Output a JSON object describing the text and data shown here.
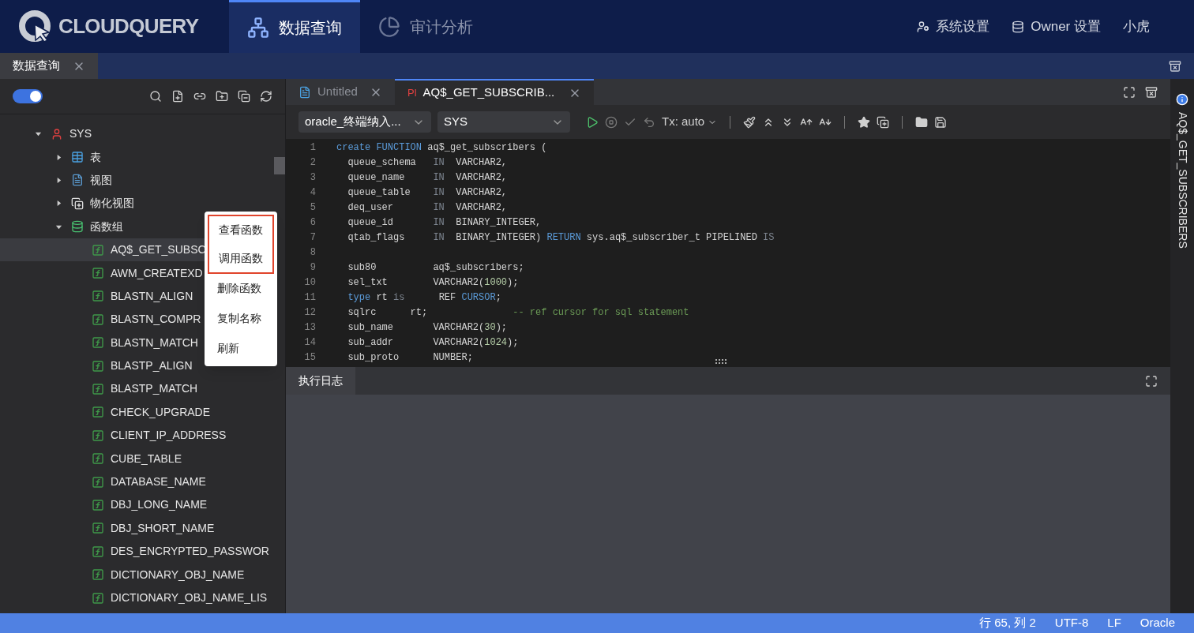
{
  "header": {
    "logo": "CLOUDQUERY",
    "nav": [
      {
        "label": "数据查询",
        "selected": true
      },
      {
        "label": "审计分析",
        "selected": false
      }
    ],
    "actions": [
      "系统设置",
      "Owner 设置",
      "小虎"
    ]
  },
  "page_tabs": [
    {
      "label": "数据查询",
      "selected": true
    }
  ],
  "sidebar": {
    "theme_toggle": {
      "on": true
    },
    "tree": [
      {
        "label": "SYS",
        "kind": "user",
        "expanded": true,
        "children": [
          {
            "label": "表",
            "kind": "table",
            "expanded": false
          },
          {
            "label": "视图",
            "kind": "view",
            "expanded": false
          },
          {
            "label": "物化视图",
            "kind": "mview",
            "expanded": false
          },
          {
            "label": "函数组",
            "kind": "funcgroup",
            "expanded": true,
            "children": [
              {
                "label": "AQ$_GET_SUBSC",
                "kind": "func",
                "selected": true
              },
              {
                "label": "AWM_CREATEXD",
                "kind": "func",
                "selected": false
              },
              {
                "label": "BLASTN_ALIGN",
                "kind": "func",
                "selected": false
              },
              {
                "label": "BLASTN_COMPR",
                "kind": "func",
                "selected": false
              },
              {
                "label": "BLASTN_MATCH",
                "kind": "func",
                "selected": false
              },
              {
                "label": "BLASTP_ALIGN",
                "kind": "func",
                "selected": false
              },
              {
                "label": "BLASTP_MATCH",
                "kind": "func",
                "selected": false
              },
              {
                "label": "CHECK_UPGRADE",
                "kind": "func",
                "selected": false
              },
              {
                "label": "CLIENT_IP_ADDRESS",
                "kind": "func",
                "selected": false
              },
              {
                "label": "CUBE_TABLE",
                "kind": "func",
                "selected": false
              },
              {
                "label": "DATABASE_NAME",
                "kind": "func",
                "selected": false
              },
              {
                "label": "DBJ_LONG_NAME",
                "kind": "func",
                "selected": false
              },
              {
                "label": "DBJ_SHORT_NAME",
                "kind": "func",
                "selected": false
              },
              {
                "label": "DES_ENCRYPTED_PASSWOR",
                "kind": "func",
                "selected": false
              },
              {
                "label": "DICTIONARY_OBJ_NAME",
                "kind": "func",
                "selected": false
              },
              {
                "label": "DICTIONARY_OBJ_NAME_LIS",
                "kind": "func",
                "selected": false
              }
            ]
          }
        ]
      }
    ]
  },
  "context_menu": [
    {
      "label": "查看函数",
      "highlighted": true
    },
    {
      "label": "调用函数",
      "highlighted": true
    },
    {
      "label": "删除函数",
      "highlighted": false
    },
    {
      "label": "复制名称",
      "highlighted": false
    },
    {
      "label": "刷新",
      "highlighted": false
    }
  ],
  "editor": {
    "tabs": [
      {
        "label": "Untitled",
        "kind": "file",
        "selected": false
      },
      {
        "label": "AQ$_GET_SUBSCRIB...",
        "kind": "plsql",
        "prefix": "Pl",
        "selected": true
      }
    ],
    "connection": "oracle_终端纳入...",
    "schema": "SYS",
    "tx": "Tx: auto",
    "lines": [
      {
        "no": "1",
        "tokens": [
          {
            "kind": "kw",
            "text": "create FUNCTION"
          },
          {
            "kind": "plain",
            "text": " aq$_get_subscribers ("
          }
        ]
      },
      {
        "no": "2",
        "tokens": [
          {
            "kind": "plain",
            "text": "  queue_schema   "
          },
          {
            "kind": "dim",
            "text": "IN"
          },
          {
            "kind": "plain",
            "text": "  VARCHAR2,"
          }
        ]
      },
      {
        "no": "3",
        "tokens": [
          {
            "kind": "plain",
            "text": "  queue_name     "
          },
          {
            "kind": "dim",
            "text": "IN"
          },
          {
            "kind": "plain",
            "text": "  VARCHAR2,"
          }
        ]
      },
      {
        "no": "4",
        "tokens": [
          {
            "kind": "plain",
            "text": "  queue_table    "
          },
          {
            "kind": "dim",
            "text": "IN"
          },
          {
            "kind": "plain",
            "text": "  VARCHAR2,"
          }
        ]
      },
      {
        "no": "5",
        "tokens": [
          {
            "kind": "plain",
            "text": "  deq_user       "
          },
          {
            "kind": "dim",
            "text": "IN"
          },
          {
            "kind": "plain",
            "text": "  VARCHAR2,"
          }
        ]
      },
      {
        "no": "6",
        "tokens": [
          {
            "kind": "plain",
            "text": "  queue_id       "
          },
          {
            "kind": "dim",
            "text": "IN"
          },
          {
            "kind": "plain",
            "text": "  BINARY_INTEGER,"
          }
        ]
      },
      {
        "no": "7",
        "tokens": [
          {
            "kind": "plain",
            "text": "  qtab_flags     "
          },
          {
            "kind": "dim",
            "text": "IN"
          },
          {
            "kind": "plain",
            "text": "  BINARY_INTEGER) "
          },
          {
            "kind": "kw",
            "text": "RETURN"
          },
          {
            "kind": "plain",
            "text": " sys.aq$_subscriber_t PIPELINED "
          },
          {
            "kind": "dim",
            "text": "IS"
          }
        ]
      },
      {
        "no": "8"
      },
      {
        "no": "9",
        "tokens": [
          {
            "kind": "plain",
            "text": "  sub80          aq$_subscribers;"
          }
        ]
      },
      {
        "no": "10",
        "tokens": [
          {
            "kind": "plain",
            "text": "  sel_txt        VARCHAR2("
          },
          {
            "kind": "num",
            "text": "1000"
          },
          {
            "kind": "plain",
            "text": ");"
          }
        ]
      },
      {
        "no": "11",
        "tokens": [
          {
            "kind": "kw",
            "text": "  type"
          },
          {
            "kind": "plain",
            "text": " rt "
          },
          {
            "kind": "dim",
            "text": "is"
          },
          {
            "kind": "plain",
            "text": "      REF "
          },
          {
            "kind": "kw",
            "text": "CURSOR"
          },
          {
            "kind": "plain",
            "text": ";"
          }
        ]
      },
      {
        "no": "12",
        "tokens": [
          {
            "kind": "plain",
            "text": "  sqlrc      rt;               "
          },
          {
            "kind": "comment",
            "text": "-- ref cursor for sql statement"
          }
        ]
      },
      {
        "no": "13",
        "tokens": [
          {
            "kind": "plain",
            "text": "  sub_name       VARCHAR2("
          },
          {
            "kind": "num",
            "text": "30"
          },
          {
            "kind": "plain",
            "text": ");"
          }
        ]
      },
      {
        "no": "14",
        "tokens": [
          {
            "kind": "plain",
            "text": "  sub_addr       VARCHAR2("
          },
          {
            "kind": "num",
            "text": "1024"
          },
          {
            "kind": "plain",
            "text": ");"
          }
        ]
      },
      {
        "no": "15",
        "tokens": [
          {
            "kind": "plain",
            "text": "  sub_proto      NUMBER;"
          }
        ]
      }
    ]
  },
  "log_panel": {
    "tabs": [
      {
        "label": "执行日志",
        "selected": true
      }
    ]
  },
  "right_rail": {
    "label": "AQ$_GET_SUBSCRIBERS"
  },
  "status_bar": [
    "行 65, 列 2",
    "UTF-8",
    "LF",
    "Oracle"
  ]
}
